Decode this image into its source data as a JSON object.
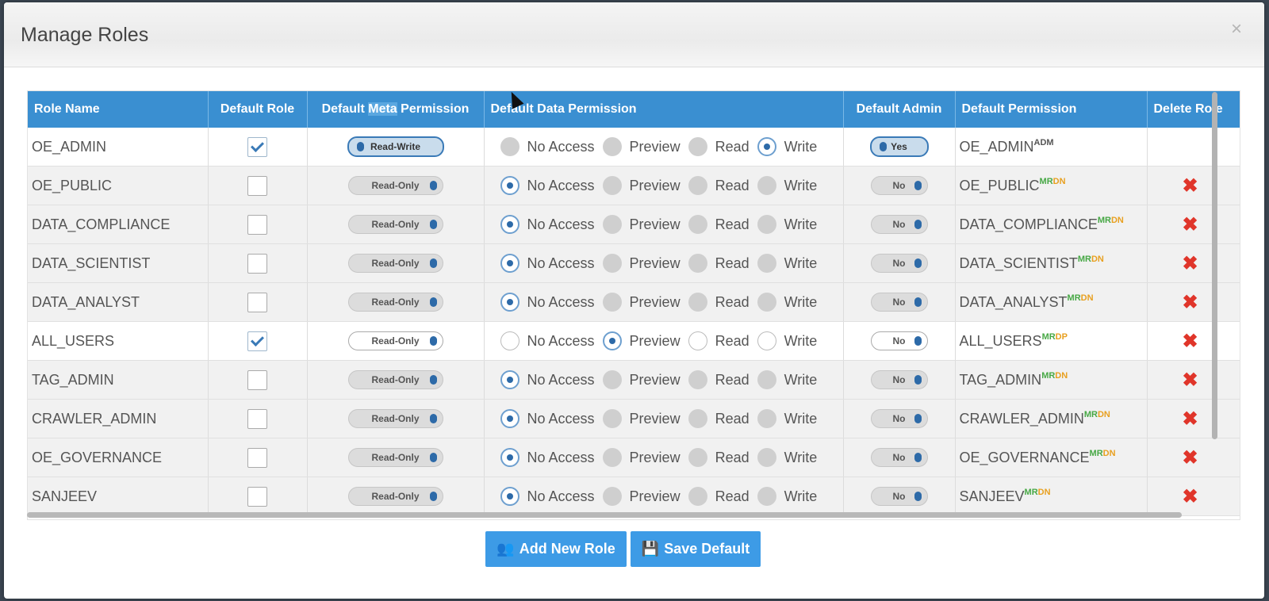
{
  "modal": {
    "title": "Manage Roles",
    "close": "×"
  },
  "columns": {
    "role_name": "Role Name",
    "default_role": "Default Role",
    "meta_a": "Default ",
    "meta_hl": "Meta",
    "meta_b": " Permission",
    "data_perm": "Default Data Permission",
    "default_admin": "Default Admin",
    "default_permission": "Default Permission",
    "delete_role": "Delete Role"
  },
  "radio_labels": {
    "no_access": "No Access",
    "preview": "Preview",
    "read": "Read",
    "write": "Write"
  },
  "rows": [
    {
      "name": "OE_ADMIN",
      "default_role": true,
      "meta": "Read-Write",
      "data": "write",
      "admin": "Yes",
      "perm": "OE_ADMIN",
      "sup1": "ADM",
      "sup2": "",
      "deletable": false
    },
    {
      "name": "OE_PUBLIC",
      "default_role": false,
      "meta": "Read-Only",
      "data": "no_access",
      "admin": "No",
      "perm": "OE_PUBLIC",
      "sup1": "MR",
      "sup2": "DN",
      "deletable": true
    },
    {
      "name": "DATA_COMPLIANCE",
      "default_role": false,
      "meta": "Read-Only",
      "data": "no_access",
      "admin": "No",
      "perm": "DATA_COMPLIANCE",
      "sup1": "MR",
      "sup2": "DN",
      "deletable": true
    },
    {
      "name": "DATA_SCIENTIST",
      "default_role": false,
      "meta": "Read-Only",
      "data": "no_access",
      "admin": "No",
      "perm": "DATA_SCIENTIST",
      "sup1": "MR",
      "sup2": "DN",
      "deletable": true
    },
    {
      "name": "DATA_ANALYST",
      "default_role": false,
      "meta": "Read-Only",
      "data": "no_access",
      "admin": "No",
      "perm": "DATA_ANALYST",
      "sup1": "MR",
      "sup2": "DN",
      "deletable": true
    },
    {
      "name": "ALL_USERS",
      "default_role": true,
      "meta": "Read-Only",
      "data": "preview",
      "admin": "No",
      "perm": "ALL_USERS",
      "sup1": "MR",
      "sup2": "DP",
      "deletable": true
    },
    {
      "name": "TAG_ADMIN",
      "default_role": false,
      "meta": "Read-Only",
      "data": "no_access",
      "admin": "No",
      "perm": "TAG_ADMIN",
      "sup1": "MR",
      "sup2": "DN",
      "deletable": true
    },
    {
      "name": "CRAWLER_ADMIN",
      "default_role": false,
      "meta": "Read-Only",
      "data": "no_access",
      "admin": "No",
      "perm": "CRAWLER_ADMIN",
      "sup1": "MR",
      "sup2": "DN",
      "deletable": true
    },
    {
      "name": "OE_GOVERNANCE",
      "default_role": false,
      "meta": "Read-Only",
      "data": "no_access",
      "admin": "No",
      "perm": "OE_GOVERNANCE",
      "sup1": "MR",
      "sup2": "DN",
      "deletable": true
    },
    {
      "name": "SANJEEV",
      "default_role": false,
      "meta": "Read-Only",
      "data": "no_access",
      "admin": "No",
      "perm": "SANJEEV",
      "sup1": "MR",
      "sup2": "DN",
      "deletable": true
    }
  ],
  "delete_glyph": "✖",
  "buttons": {
    "add": "Add New Role",
    "save": "Save Default"
  },
  "icons": {
    "add": "users-icon",
    "save": "floppy-disk-icon"
  },
  "colors": {
    "header": "#3a8fd1",
    "button": "#3d9be6",
    "delete": "#e0352a",
    "sup_green": "#47a845",
    "sup_orange": "#e8a020"
  }
}
